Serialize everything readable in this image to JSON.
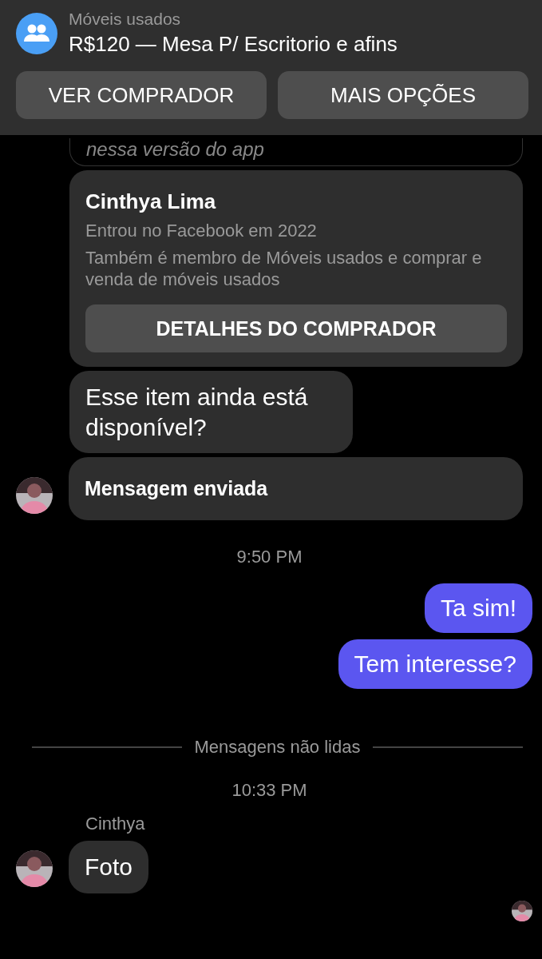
{
  "header": {
    "group": "Móveis usados",
    "title": "R$120 — Mesa P/ Escritorio e afins",
    "buttons": [
      "VER COMPRADOR",
      "MAIS OPÇÕES"
    ]
  },
  "messages": [
    {
      "kind": "note",
      "text": "nessa versão do app"
    },
    {
      "kind": "card",
      "name": "Cinthya Lima",
      "lines": [
        "Entrou no Facebook em 2022",
        "Também é membro de Móveis usados e comprar e venda de móveis usados"
      ],
      "button": "DETALHES DO COMPRADOR"
    },
    {
      "kind": "received",
      "text": "Esse item ainda está disponível?"
    },
    {
      "kind": "received",
      "text": "Mensagem enviada",
      "bold": true,
      "avatar": true
    },
    {
      "kind": "time",
      "text": "9:50 PM"
    },
    {
      "kind": "sent",
      "text": "Ta sim!"
    },
    {
      "kind": "sent",
      "text": "Tem interesse?"
    },
    {
      "kind": "divider",
      "text": "Mensagens não lidas"
    },
    {
      "kind": "time",
      "text": "10:33 PM"
    },
    {
      "kind": "sender",
      "text": "Cinthya"
    },
    {
      "kind": "received",
      "text": "Foto",
      "avatar": true
    },
    {
      "kind": "seen"
    }
  ]
}
